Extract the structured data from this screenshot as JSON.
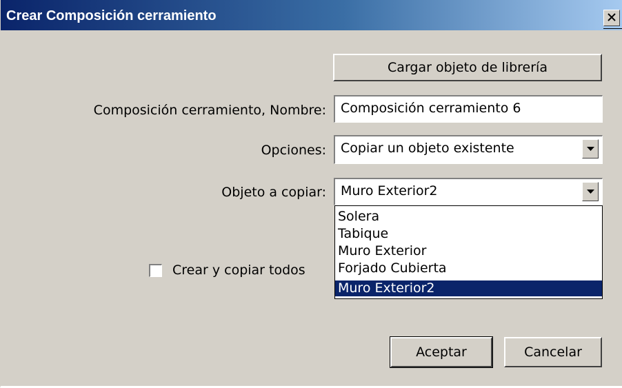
{
  "window": {
    "title": "Crear Composición cerramiento",
    "close_icon": "close-icon"
  },
  "buttons": {
    "load_library": "Cargar objeto de librería",
    "accept": "Aceptar",
    "cancel": "Cancelar"
  },
  "form": {
    "name_label": "Composición cerramiento, Nombre:",
    "name_value": "Composición cerramiento 6",
    "options_label": "Opciones:",
    "options_value": "Copiar un objeto existente",
    "copy_object_label": "Objeto a copiar:",
    "copy_object_value": "Muro Exterior2",
    "copy_all_label": "Crear y copiar todos",
    "copy_all_checked": false
  },
  "dropdown": {
    "items": [
      {
        "label": "Solera"
      },
      {
        "label": "Tabique"
      },
      {
        "label": "Muro Exterior"
      },
      {
        "label": "Forjado Cubierta"
      },
      {
        "label": "Muro Exterior2"
      }
    ],
    "selected_index": 4
  },
  "colors": {
    "title_gradient_start": "#0a246a",
    "title_gradient_end": "#a6caf0",
    "dialog_bg": "#d4d0c8",
    "selection": "#0a246a"
  }
}
